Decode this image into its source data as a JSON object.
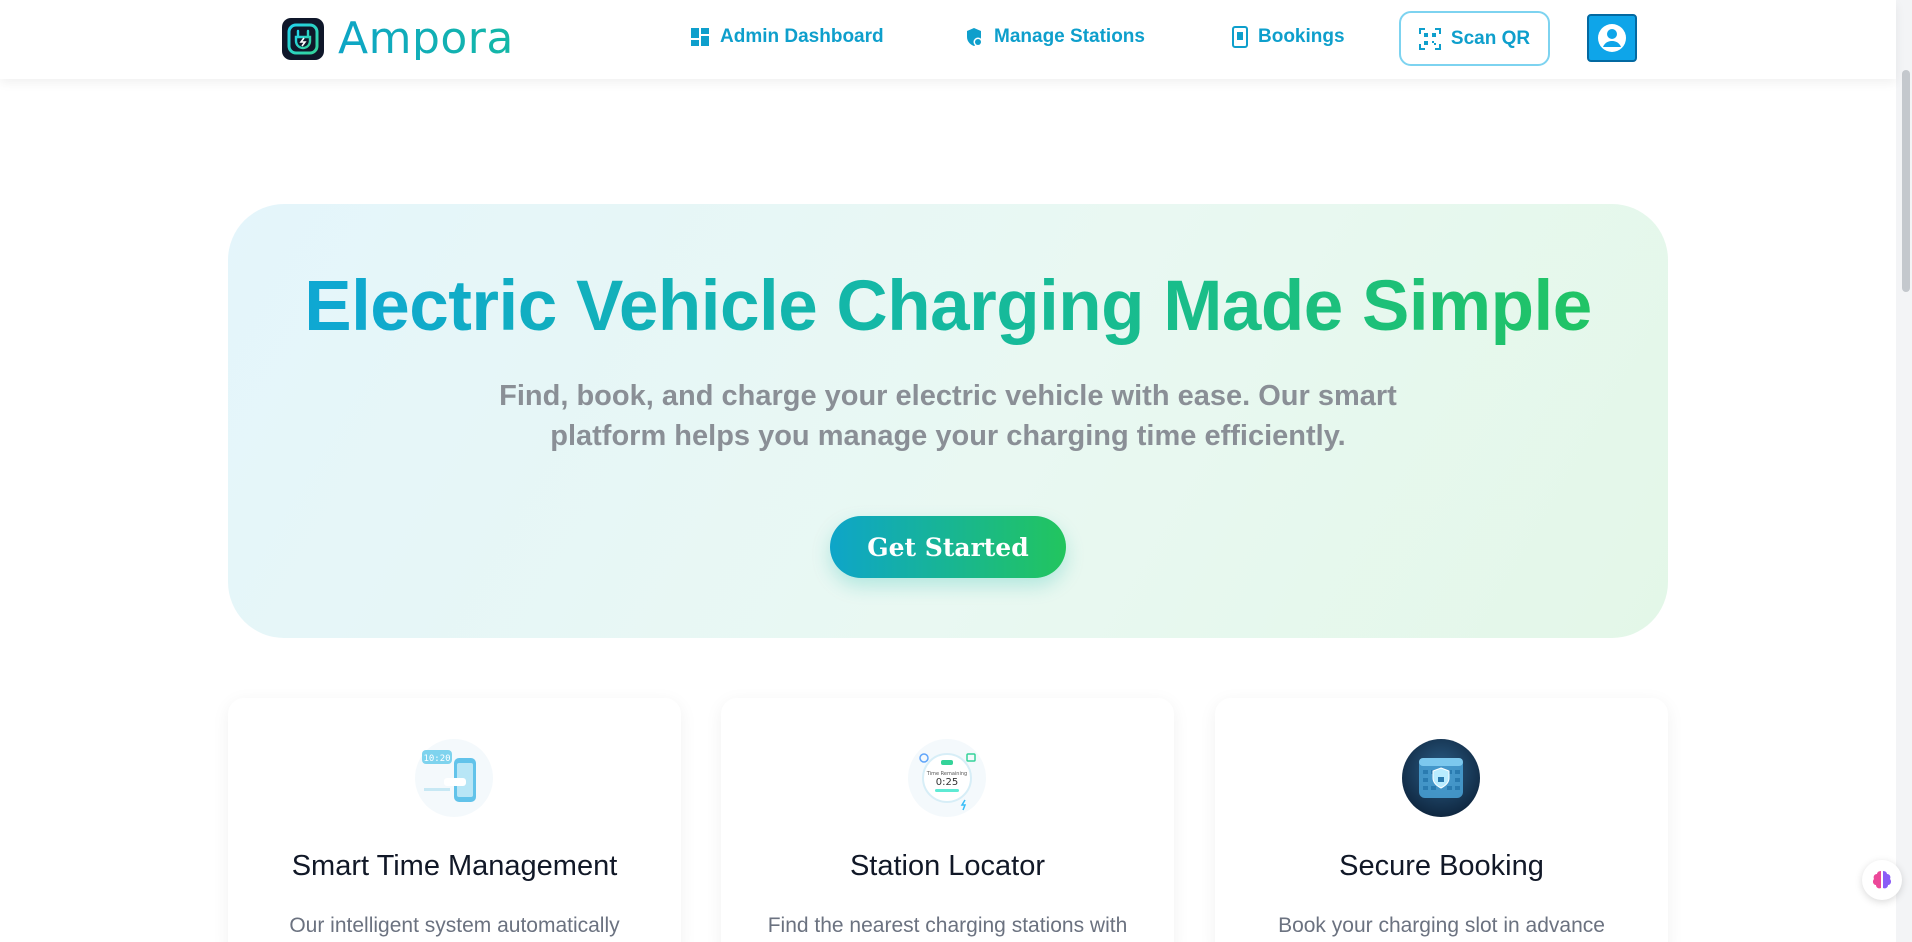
{
  "brand": {
    "name": "Ampora"
  },
  "nav": {
    "items": [
      {
        "label": "Admin Dashboard",
        "icon": "dashboard-icon"
      },
      {
        "label": "Manage Stations",
        "icon": "station-settings-icon"
      },
      {
        "label": "Bookings",
        "icon": "bookings-icon"
      }
    ],
    "scan_label": "Scan QR",
    "scan_icon": "qr-scan-icon",
    "profile_icon": "user-avatar-icon"
  },
  "hero": {
    "title": "Electric Vehicle Charging Made Simple",
    "subtitle": "Find, book, and charge your electric vehicle with ease. Our smart platform helps you manage your charging time efficiently.",
    "cta_label": "Get Started"
  },
  "features": [
    {
      "title": "Smart Time Management",
      "text": "Our intelligent system automatically",
      "icon": "phone-clock-icon"
    },
    {
      "title": "Station Locator",
      "text": "Find the nearest charging stations with",
      "icon": "timer-dashboard-icon"
    },
    {
      "title": "Secure Booking",
      "text": "Book your charging slot in advance",
      "icon": "shield-calendar-icon"
    }
  ],
  "colors": {
    "accent": "#0e9fcc",
    "gradient_start": "#0ea5d9",
    "gradient_end": "#22c55e",
    "subtitle_gray": "#8a8f96"
  }
}
